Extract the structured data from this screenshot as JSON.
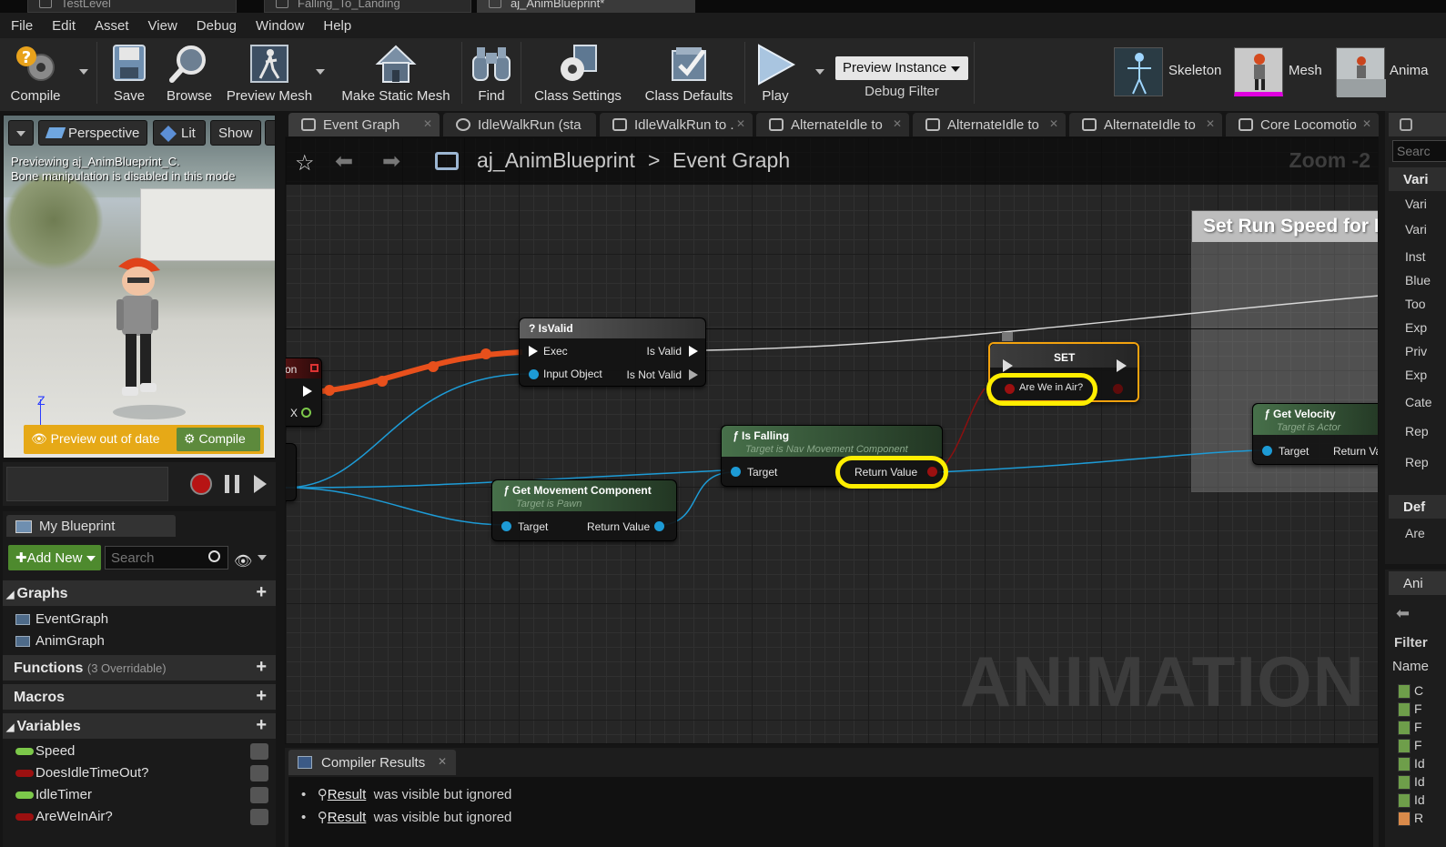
{
  "doc_tabs": [
    {
      "label": "TestLevel",
      "active": false
    },
    {
      "label": "Falling_To_Landing",
      "active": false
    },
    {
      "label": "aj_AnimBlueprint*",
      "active": true
    }
  ],
  "menu": [
    "File",
    "Edit",
    "Asset",
    "View",
    "Debug",
    "Window",
    "Help"
  ],
  "toolbar": {
    "compile": "Compile",
    "save": "Save",
    "browse": "Browse",
    "preview_mesh": "Preview Mesh",
    "make_static_mesh": "Make Static Mesh",
    "find": "Find",
    "class_settings": "Class Settings",
    "class_defaults": "Class Defaults",
    "play": "Play",
    "preview_instance": "Preview Instance",
    "debug_filter": "Debug Filter",
    "assets": {
      "skeleton": "Skeleton",
      "mesh": "Mesh",
      "animation": "Anima"
    }
  },
  "viewport": {
    "perspective": "Perspective",
    "lit": "Lit",
    "show": "Show",
    "notice_line1": "Previewing aj_AnimBlueprint_C.",
    "notice_line2": "Bone manipulation is disabled in this mode",
    "preview_out_of_date": "Preview out of date",
    "compile": "Compile",
    "axis_z": "Z"
  },
  "my_blueprint": {
    "tab": "My Blueprint",
    "add_new": "Add New",
    "search_placeholder": "Search",
    "graphs_header": "Graphs",
    "graphs": [
      "EventGraph",
      "AnimGraph"
    ],
    "functions_header": "Functions",
    "functions_note": "(3 Overridable)",
    "macros_header": "Macros",
    "variables_header": "Variables",
    "variables": [
      {
        "name": "Speed",
        "color": "#7cc84a"
      },
      {
        "name": "DoesIdleTimeOut?",
        "color": "#9b1010"
      },
      {
        "name": "IdleTimer",
        "color": "#7cc84a"
      },
      {
        "name": "AreWeInAir?",
        "color": "#9b1010"
      }
    ]
  },
  "graph_tabs": [
    {
      "label": "Event Graph",
      "active": true
    },
    {
      "label": "IdleWalkRun (sta",
      "active": false
    },
    {
      "label": "IdleWalkRun to .",
      "active": false
    },
    {
      "label": "AlternateIdle to",
      "active": false
    },
    {
      "label": "AlternateIdle to",
      "active": false
    },
    {
      "label": "AlternateIdle to",
      "active": false
    },
    {
      "label": "Core Locomotio",
      "active": false
    }
  ],
  "graph": {
    "breadcrumb_blueprint": "aj_AnimBlueprint",
    "breadcrumb_separator": ">",
    "breadcrumb_graph": "Event Graph",
    "zoom": "Zoom -2",
    "watermark": "ANIMATION",
    "comment_title": "Set Run Speed for I",
    "left_node_label": "on",
    "left_node_pin": "X",
    "nodes": {
      "isvalid": {
        "title": "IsValid",
        "exec": "Exec",
        "input": "Input Object",
        "valid": "Is Valid",
        "not_valid": "Is Not Valid"
      },
      "set": {
        "title": "SET",
        "pin": "Are We in Air?"
      },
      "is_falling": {
        "title": "Is Falling",
        "subtitle": "Target is Nav Movement Component",
        "target": "Target",
        "return": "Return Value"
      },
      "get_movement": {
        "title": "Get Movement Component",
        "subtitle": "Target is Pawn",
        "target": "Target",
        "return": "Return Value"
      },
      "get_velocity": {
        "title": "Get Velocity",
        "subtitle": "Target is Actor",
        "target": "Target",
        "return": "Return Va"
      }
    }
  },
  "compiler": {
    "tab": "Compiler Results",
    "lines": [
      {
        "token": "Result",
        "text": "was visible but ignored"
      },
      {
        "token": "Result",
        "text": "was visible but ignored"
      }
    ]
  },
  "details": {
    "search_placeholder": "Searc",
    "variable_header": "Vari",
    "rows": [
      "Vari",
      "Vari",
      "Inst",
      "Blue",
      "Too",
      "Exp",
      "Priv",
      "Exp",
      "Cate",
      "Rep",
      "Rep"
    ],
    "default_header": "Def",
    "default_row": "Are"
  },
  "asset_panel": {
    "tab": "Ani",
    "filter": "Filter",
    "name_col": "Name",
    "items": [
      "C",
      "F",
      "F",
      "F",
      "Id",
      "Id",
      "Id",
      "R"
    ]
  }
}
